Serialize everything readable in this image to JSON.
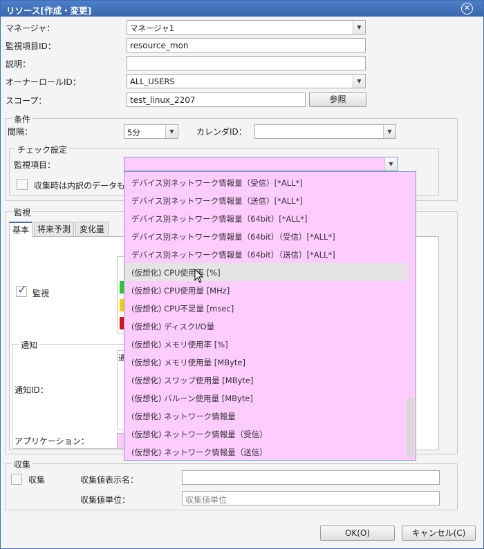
{
  "window": {
    "title": "リソース[作成・変更]",
    "close_symbol": "✕"
  },
  "form": {
    "manager_label": "マネージャ：",
    "manager_value": "マネージャ1",
    "monitor_id_label": "監視項目ID：",
    "monitor_id_value": "resource_mon",
    "description_label": "説明：",
    "description_value": "",
    "owner_role_label": "オーナーロールID：",
    "owner_role_value": "ALL_USERS",
    "scope_label": "スコープ：",
    "scope_value": "test_linux_2207",
    "reference_button": "参照"
  },
  "condition": {
    "title": "条件",
    "interval_label": "間隔：",
    "interval_value": "5分",
    "calendar_label": "カレンダID：",
    "calendar_value": ""
  },
  "check": {
    "title": "チェック設定",
    "monitor_item_label": "監視項目：",
    "monitor_item_value": "",
    "breakdown_label": "収集時は内訳のデータも"
  },
  "dropdown": {
    "items": [
      "デバイス別ネットワーク情報量（受信）[*ALL*]",
      "デバイス別ネットワーク情報量（送信）[*ALL*]",
      "デバイス別ネットワーク情報量（64bit）[*ALL*]",
      "デバイス別ネットワーク情報量（64bit）（受信）[*ALL*]",
      "デバイス別ネットワーク情報量（64bit）（送信）[*ALL*]",
      "(仮想化) CPU使用率 [%]",
      "(仮想化) CPU使用量 [MHz]",
      "(仮想化) CPU不足量 [msec]",
      "(仮想化) ディスクI/O量",
      "(仮想化) メモリ使用率 [%]",
      "(仮想化) メモリ使用量 [MByte]",
      "(仮想化) スワップ使用量 [MByte]",
      "(仮想化) バルーン使用量 [MByte]",
      "(仮想化) ネットワーク情報量",
      "(仮想化) ネットワーク情報量（受信）",
      "(仮想化) ネットワーク情報量（送信）"
    ],
    "highlighted_index": 5
  },
  "monitor": {
    "title": "監視",
    "tabs": [
      "基本",
      "将来予測",
      "変化量"
    ],
    "monitor_check_label": "監視",
    "notify_title": "通知",
    "notify_id_label": "通知ID：",
    "notify_header_char": "通",
    "application_label": "アプリケーション："
  },
  "collect": {
    "title": "収集",
    "collect_label": "収集",
    "display_name_label": "収集値表示名：",
    "display_name_value": "",
    "unit_label": "収集値単位：",
    "unit_placeholder": "収集値単位"
  },
  "buttons": {
    "ok": "OK(O)",
    "cancel": "キャンセル(C)"
  },
  "colors": {
    "titlebar": "#3a68ad",
    "dropdown_bg": "#ffccff",
    "status_green": "#22cc22",
    "status_yellow": "#f0d000",
    "status_red": "#dd1111"
  }
}
